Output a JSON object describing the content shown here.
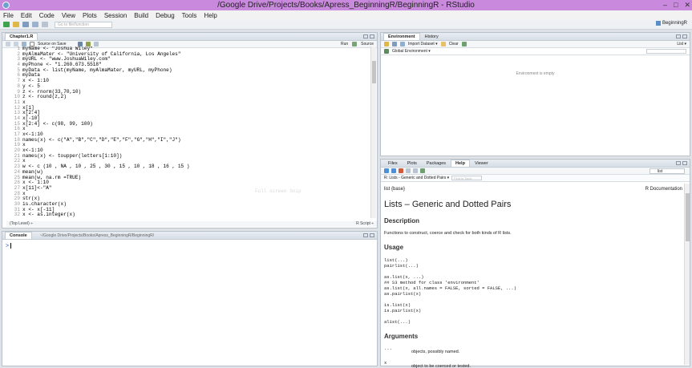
{
  "window": {
    "title": "/Google Drive/Projects/Books/Apress_BeginningR/BeginningR - RStudio",
    "controls": [
      "–",
      "□",
      "✕"
    ]
  },
  "menu": [
    "File",
    "Edit",
    "Code",
    "View",
    "Plots",
    "Session",
    "Build",
    "Debug",
    "Tools",
    "Help"
  ],
  "toolbar": {
    "goto_placeholder": "Go to file/function",
    "project": "BeginningR"
  },
  "editor": {
    "tab": "Chapter1.R",
    "source_on_save": "Source on Save",
    "run_label": "Run",
    "source_label": "Source",
    "ghost_text": "Full screen Snip",
    "line_numbers": [
      "1",
      "2",
      "3",
      "4",
      "5",
      "6",
      "7",
      "8",
      "9",
      "10",
      "11",
      "12",
      "13",
      "14",
      "15",
      "16",
      "17",
      "18",
      "19",
      "20",
      "21",
      "22",
      "23",
      "24",
      "25",
      "26",
      "27",
      "28",
      "29",
      "30",
      "31",
      "32"
    ],
    "lines": [
      "myName <- \"Joshua Wiley\"",
      "myAlmaMater <- \"University of California, Los Angeles\"",
      "myURL <- \"www.JoshuaWiley.com\"",
      "myPhone <- \"1.260.673.5518\"",
      "myData <- list(myName, myAlmaMater, myURL, myPhone)",
      "myData",
      "x <- 1:10",
      "y <- 5",
      "z <- rnorm(33,70,10)",
      "z <- round(z,2)",
      "x",
      "x[1]",
      "x[2:4]",
      "x[-10]",
      "x[2:4] <- c(98, 99, 100)",
      "x",
      "x<-1:10",
      "names(x) <- c(\"A\",\"B\",\"C\",\"D\",\"E\",\"F\",\"G\",\"H\",\"I\",\"J\")",
      "x",
      "x<-1:10",
      "names(x) <- toupper(letters[1:10])",
      "x",
      "w <- c (10 , NA , 10 , 25 , 30 , 15 , 10 , 18 , 16 , 15 )",
      "mean(w)",
      "mean(w, na.rm =TRUE)",
      "x <- 1:10",
      "x[11]<-\"A\"",
      "x",
      "str(x)",
      "is.character(x)",
      "x <- x[-11]",
      "x <- as.integer(x)"
    ],
    "status_left": "(Top Level) ÷",
    "status_right": "R Script ÷"
  },
  "console": {
    "tab": "Console",
    "path": "~/Google Drive/Projects/Books/Apress_BeginningR/BeginningR/",
    "prompt": ">"
  },
  "environment": {
    "tabs": [
      "Environment",
      "History"
    ],
    "import_label": "Import Dataset ▾",
    "clear_label": "Clear",
    "scope": "Global Environment ▾",
    "list_label": "List ▾",
    "empty_message": "Environment is empty"
  },
  "help": {
    "tabs": [
      "Files",
      "Plots",
      "Packages",
      "Help",
      "Viewer"
    ],
    "search_value": "list",
    "topic_crumb": "R: Lists - Generic and Dotted Pairs ▾",
    "find_placeholder": "Find in Topic",
    "page_left": "list {base}",
    "page_right": "R Documentation",
    "title": "Lists – Generic and Dotted Pairs",
    "desc_heading": "Description",
    "desc_text": "Functions to construct, coerce and check for both kinds of R lists.",
    "usage_heading": "Usage",
    "usage_code": "list(...)\npairlist(...)\n\nas.list(x, ...)\n## S3 method for class 'environment'\nas.list(x, all.names = FALSE, sorted = FALSE, ...)\nas.pairlist(x)\n\nis.list(x)\nis.pairlist(x)\n\nalist(...)",
    "args_heading": "Arguments",
    "arg1_name": "...",
    "arg1_desc": "objects, possibly named.",
    "arg2_name": "x",
    "arg2_desc": "object to be coerced or tested."
  }
}
